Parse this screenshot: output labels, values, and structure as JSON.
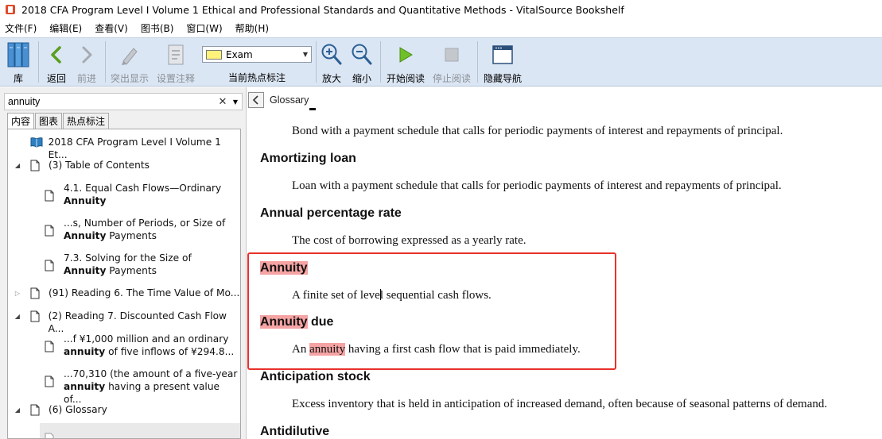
{
  "window": {
    "title": "2018 CFA Program Level I Volume 1 Ethical and Professional Standards and Quantitative Methods - VitalSource Bookshelf"
  },
  "menubar": [
    "文件(F)",
    "编辑(E)",
    "查看(V)",
    "图书(B)",
    "窗口(W)",
    "帮助(H)"
  ],
  "toolbar": {
    "library": "库",
    "back": "返回",
    "forward": "前进",
    "highlight_show": "突出显示",
    "set_note": "设置注释",
    "highlight_select_value": "Exam",
    "highlight_select_label": "当前热点标注",
    "zoom_in": "放大",
    "zoom_out": "缩小",
    "start_read": "开始阅读",
    "stop_read": "停止阅读",
    "hide_nav": "隐藏导航",
    "highlight_color": "#fff27a"
  },
  "left_pane": {
    "search_value": "annuity",
    "tabs": [
      "内容",
      "图表",
      "热点标注"
    ],
    "tree": [
      {
        "text": "2018 CFA Program Level I Volume 1 Et...",
        "bold": ""
      },
      {
        "text": "(3) Table of Contents",
        "bold": ""
      },
      {
        "text": "4.1. Equal Cash Flows—Ordinary",
        "bold": "Annuity"
      },
      {
        "text": "...s, Number of Periods, or Size of",
        "bold": "Annuity",
        "tail": " Payments"
      },
      {
        "text": "7.3. Solving for the Size of",
        "bold": "Annuity",
        "tail": " Payments"
      },
      {
        "text": "(91) Reading 6. The Time Value of Mo...",
        "bold": ""
      },
      {
        "text": "(2) Reading 7. Discounted Cash Flow A...",
        "bold": ""
      },
      {
        "text": "...f ¥1,000 million and an ordinary",
        "bold": "annuity",
        "tail": " of five inflows of ¥294.8..."
      },
      {
        "text": "...70,310 (the amount of a five-year",
        "bold": "annuity",
        "tail": " having a present value of..."
      },
      {
        "text": "(6) Glossary",
        "bold": ""
      }
    ]
  },
  "doc": {
    "breadcrumb": "Glossary",
    "entries": [
      {
        "def": "Bond with a payment schedule that calls for periodic payments of interest and repayments of principal."
      },
      {
        "term": "Amortizing loan",
        "def": "Loan with a payment schedule that calls for periodic payments of interest and repayments of principal."
      },
      {
        "term": "Annual percentage rate",
        "def": "The cost of borrowing expressed as a yearly rate."
      },
      {
        "term": "Annuity",
        "def_a": "A finite set of leve",
        "def_b": "l sequential cash flows."
      },
      {
        "term_mark": "Annuity",
        "term_rest": " due",
        "def_pre": "An ",
        "def_mark": "annuity",
        "def_post": " having a first cash flow that is paid immediately."
      },
      {
        "term": "Anticipation stock",
        "def": "Excess inventory that is held in anticipation of increased demand, often because of seasonal patterns of demand."
      },
      {
        "term": "Antidilutive"
      }
    ],
    "highlight_color": "#f5a3a3",
    "annotation_box_color": "#e8312c"
  }
}
